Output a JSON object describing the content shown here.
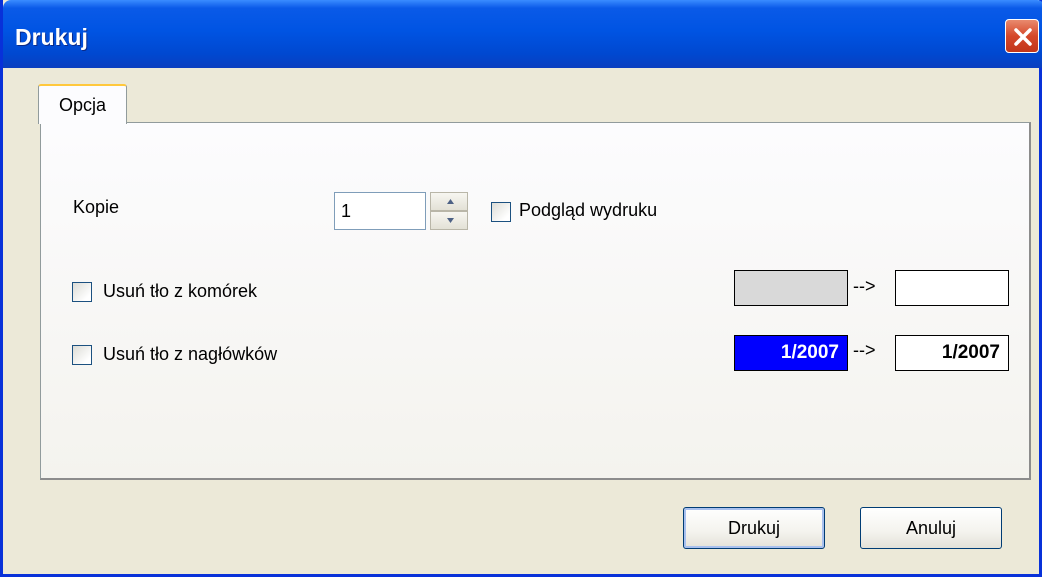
{
  "window": {
    "title": "Drukuj"
  },
  "tabs": [
    {
      "label": "Opcja"
    }
  ],
  "copies": {
    "label": "Kopie",
    "value": "1"
  },
  "preview": {
    "label": "Podgląd wydruku",
    "checked": false
  },
  "remove_cell_bg": {
    "label": "Usuń tło z komórek",
    "checked": false,
    "from_color": "#d9d9d9",
    "arrow": "-->",
    "to_color": "#ffffff"
  },
  "remove_header_bg": {
    "label": "Usuń tło z nagłówków",
    "checked": false,
    "from_text": "1/2007",
    "from_bg": "#0000ff",
    "from_fg": "#ffffff",
    "arrow": "-->",
    "to_text": "1/2007",
    "to_bg": "#ffffff",
    "to_fg": "#000000"
  },
  "buttons": {
    "print": "Drukuj",
    "cancel": "Anuluj"
  },
  "icons": {
    "close": "close-icon",
    "spin_up": "spin-up-icon",
    "spin_down": "spin-down-icon"
  }
}
